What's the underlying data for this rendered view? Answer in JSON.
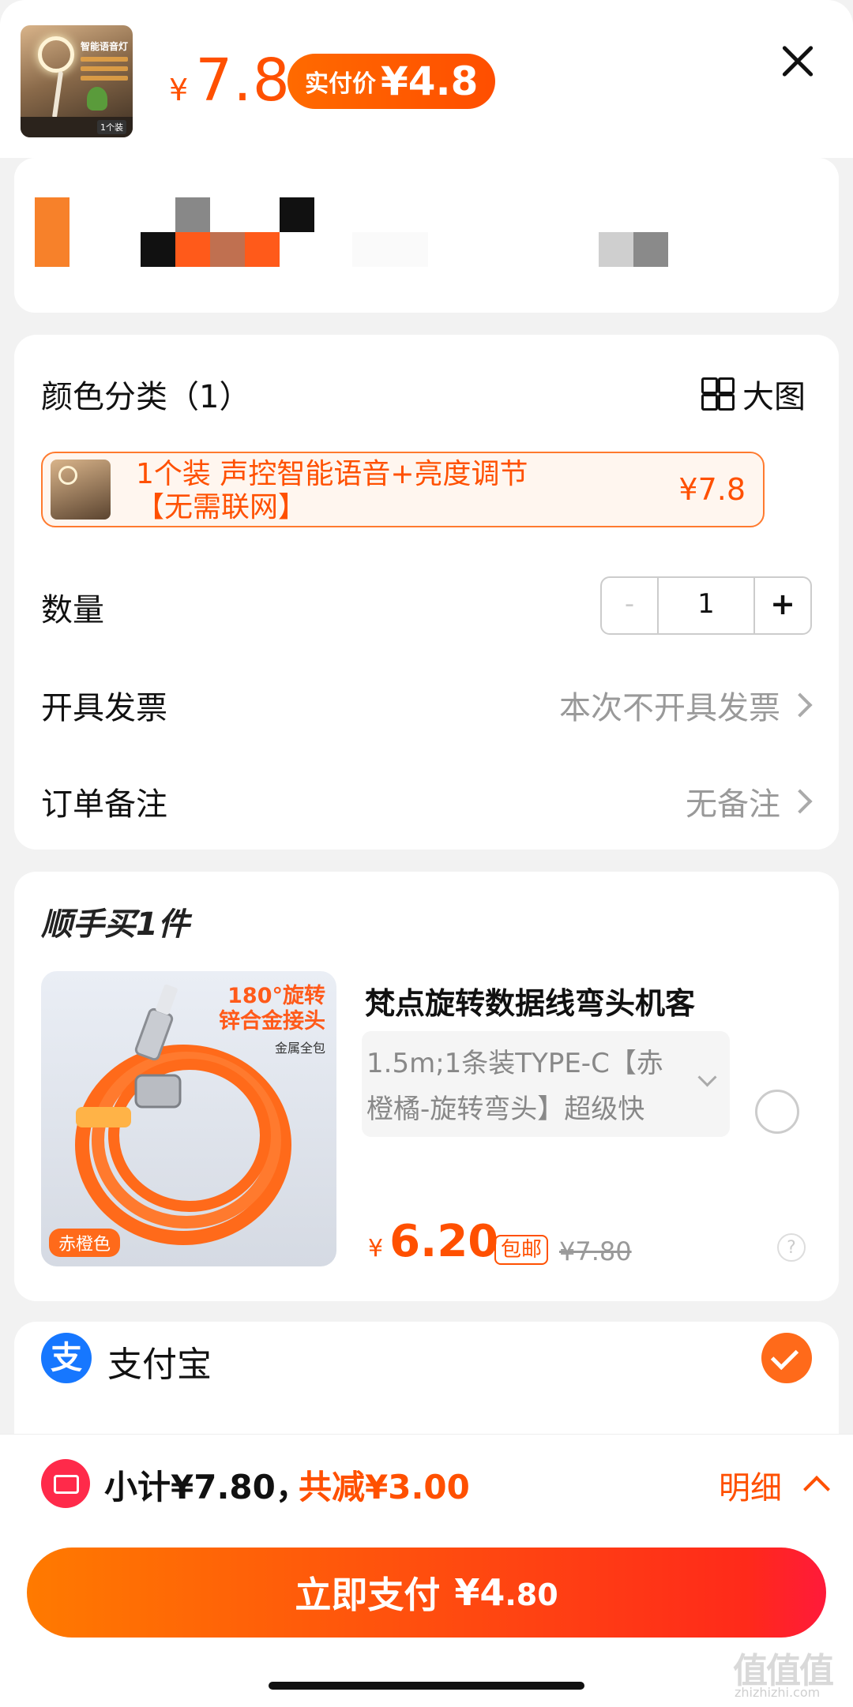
{
  "header": {
    "price": "7.8",
    "currency": "¥",
    "pay_label": "实付价",
    "pay_amount": "¥4.8",
    "thumb_tag": "智能语音灯",
    "thumb_count": "1个装"
  },
  "spec": {
    "color_label": "颜色分类（1）",
    "big_image_label": "大图",
    "sku_text": "1个装 声控智能语音+亮度调节【无需联网】",
    "sku_price": "¥7.8",
    "quantity_label": "数量",
    "quantity_minus": "-",
    "quantity_value": "1",
    "quantity_plus": "+",
    "invoice_label": "开具发票",
    "invoice_value": "本次不开具发票",
    "note_label": "订单备注",
    "note_value": "无备注"
  },
  "addon": {
    "title": "顺手买1件",
    "image_text_1": "180°旋转",
    "image_text_2": "锌合金接头",
    "image_text_3": "金属全包",
    "image_badge": "赤橙色",
    "name": "梵点旋转数据线弯头机客",
    "spec_text": "1.5m;1条装TYPE-C【赤橙橘-旋转弯头】超级快",
    "currency": "¥",
    "price": "6.20",
    "shipping": "包邮",
    "original_price": "¥7.80",
    "help": "?"
  },
  "payment": {
    "method_icon": "支",
    "method_label": "支付宝"
  },
  "footer": {
    "subtotal": "小计¥7.80，",
    "discount": "共减¥3.00",
    "detail_label": "明细",
    "pay_button_label": "立即支付",
    "pay_button_amount": "¥4",
    "pay_button_decimal": ".80",
    "watermark": "值值值",
    "watermark_sub": "zhizhizhi.com"
  },
  "colors": {
    "accent": "#ff5000",
    "alipay": "#1677ff",
    "coupon": "#ff2a4a"
  }
}
